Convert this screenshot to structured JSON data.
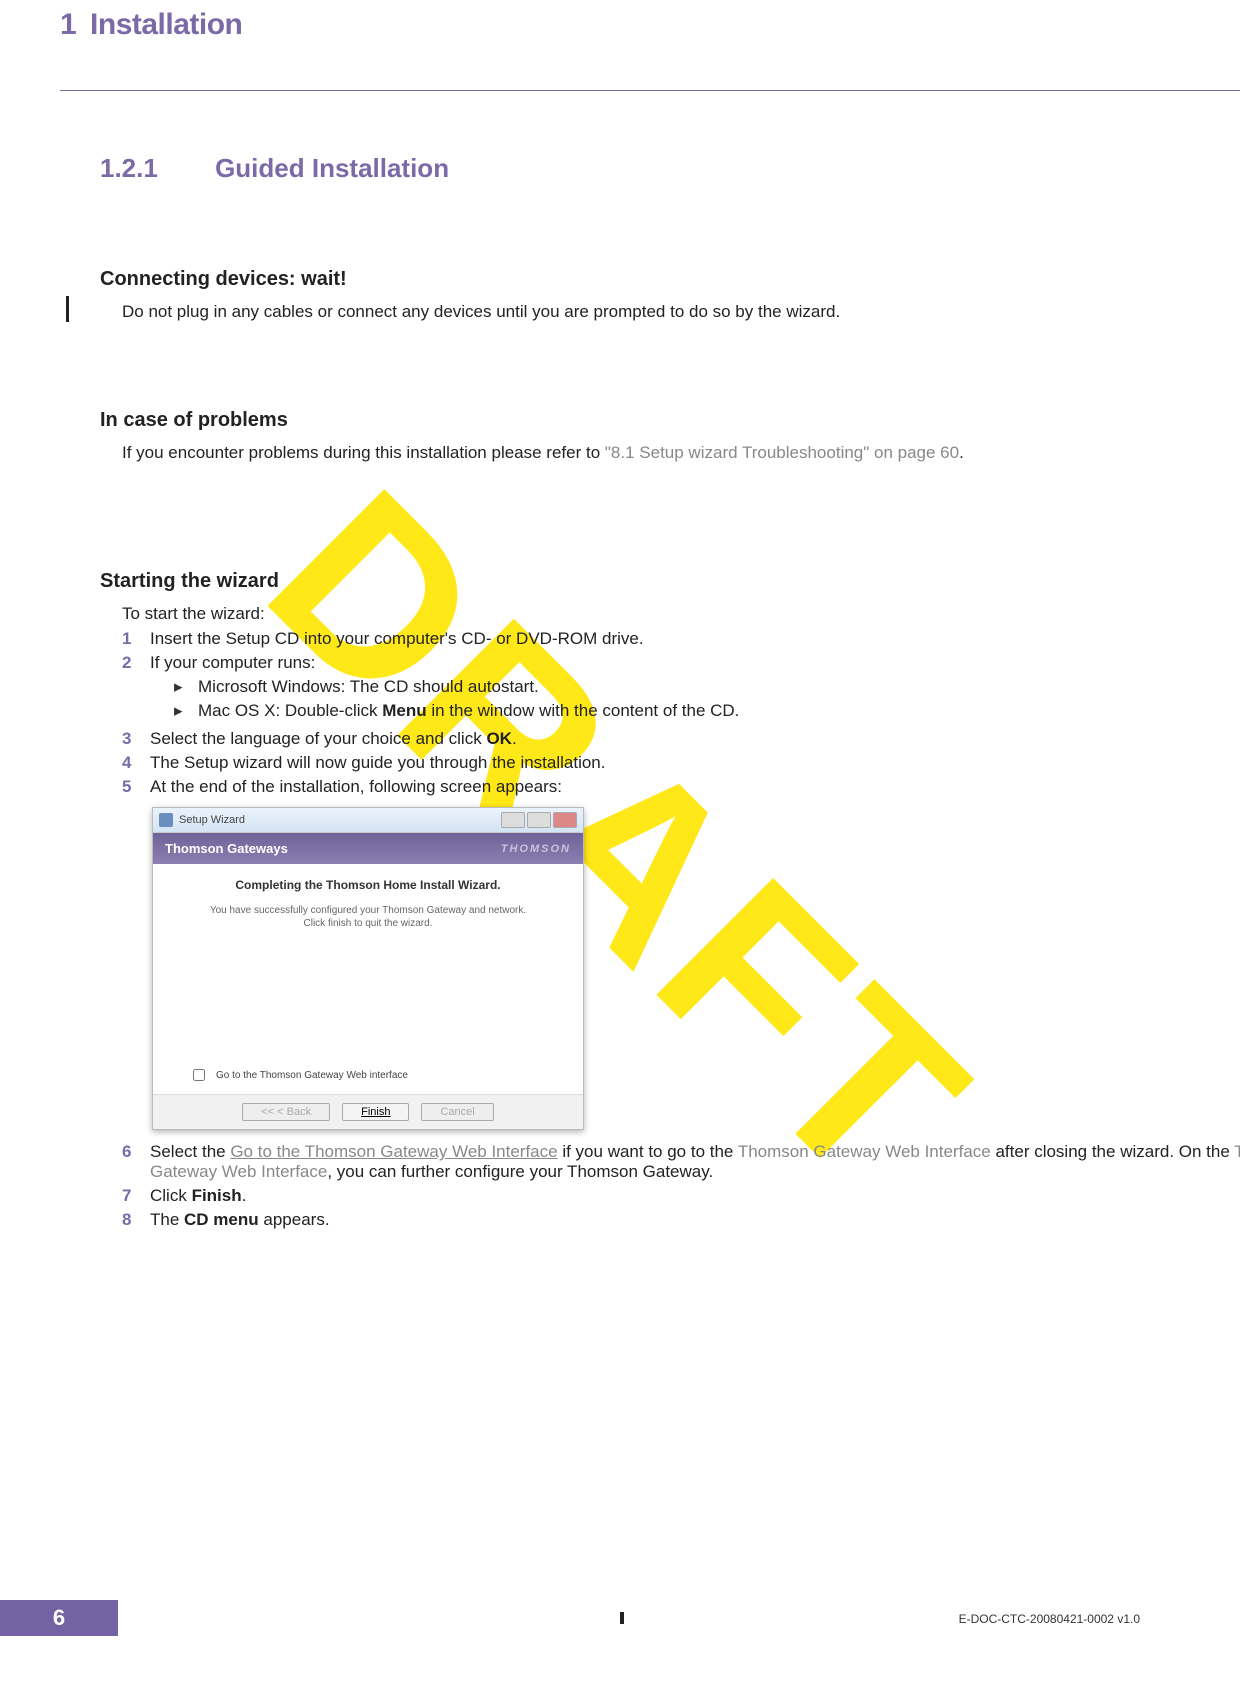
{
  "header": {
    "number": "1",
    "title": "Installation"
  },
  "section": {
    "number": "1.2.1",
    "title": "Guided Installation"
  },
  "blocks": {
    "connecting": {
      "heading": "Connecting devices: wait!",
      "text": "Do not plug in any cables or connect any devices until you are prompted to do so by the wizard."
    },
    "problems": {
      "heading": "In case of problems",
      "text_pre": "If you encounter problems during this installation please refer to ",
      "link": "\"8.1 Setup wizard Troubleshooting\" on page 60",
      "text_post": "."
    },
    "wizard": {
      "heading": "Starting the wizard",
      "intro": "To start the wizard:",
      "steps": {
        "s1": "Insert the Setup CD into your computer's CD- or DVD-ROM drive.",
        "s2": "If your computer runs:",
        "s2a": "Microsoft Windows: The CD should autostart.",
        "s2b_pre": "Mac OS X: Double-click ",
        "s2b_bold": "Menu",
        "s2b_post": " in the window with the content of the CD.",
        "s3_pre": "Select the language of your choice and click ",
        "s3_bold": "OK",
        "s3_post": ".",
        "s4": "The Setup wizard will now guide you through the installation.",
        "s5": "At the end of the installation, following screen appears:",
        "s6_pre": "Select the ",
        "s6_link1": "Go to the Thomson Gateway Web Interface",
        "s6_mid1": " if you want to go to the ",
        "s6_link2": "Thomson Gateway Web Interface",
        "s6_mid2": " after closing the wizard. On the ",
        "s6_link3": "Thomson Gateway Web Interface",
        "s6_post": ", you can further configure your Thomson Gateway.",
        "s7_pre": "Click ",
        "s7_bold": "Finish",
        "s7_post": ".",
        "s8_pre": "The ",
        "s8_bold": "CD menu",
        "s8_post": " appears."
      }
    }
  },
  "dialog": {
    "titlebar": "Setup Wizard",
    "header_left": "Thomson Gateways",
    "header_right": "THOMSON",
    "message": "Completing the Thomson Home Install Wizard.",
    "subtext1": "You have successfully configured your Thomson Gateway and network.",
    "subtext2": "Click finish to quit the wizard.",
    "checkbox": "Go to the Thomson Gateway Web interface",
    "back_btn": "<<  < Back",
    "finish_btn": "Finish",
    "cancel_btn": "Cancel"
  },
  "watermark": "DRAFT",
  "footer": {
    "page": "6",
    "docid": "E-DOC-CTC-20080421-0002 v1.0"
  }
}
